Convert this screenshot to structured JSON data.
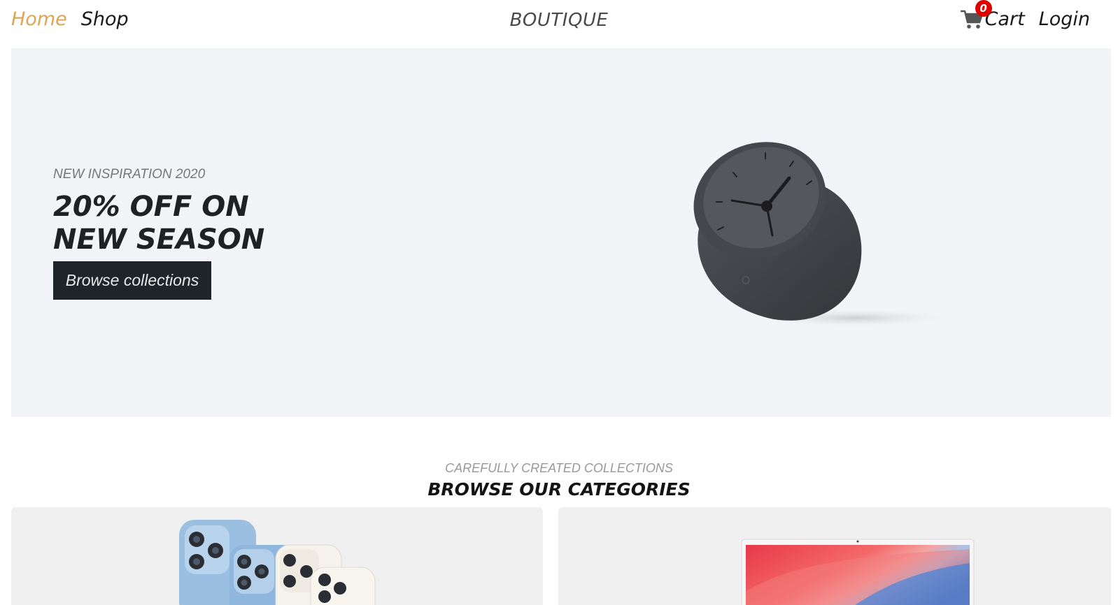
{
  "nav": {
    "home": "Home",
    "shop": "Shop",
    "brand": "BOUTIQUE",
    "cart": "Cart",
    "cart_count": "0",
    "login": "Login"
  },
  "hero": {
    "subtitle": "NEW INSPIRATION 2020",
    "title": "20% OFF ON NEW SEASON",
    "button": "Browse collections"
  },
  "categories": {
    "subtitle": "CAREFULLY CREATED COLLECTIONS",
    "title": "BROWSE OUR CATEGORIES"
  },
  "colors": {
    "accent": "#dca659",
    "badge": "#e00000",
    "hero_bg": "#f3f4f7",
    "button_bg": "#1f2428"
  }
}
